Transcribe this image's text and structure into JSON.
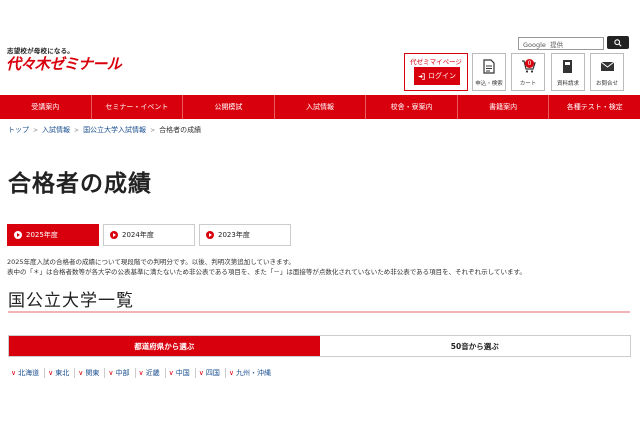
{
  "header": {
    "tagline": "志望校が母校になる。",
    "logo": "代ゼミ代々木ゼミナール",
    "logo_display": "代々木ゼミナール",
    "search": {
      "google_label": "Google",
      "provided": "提供"
    },
    "mypage": {
      "title": "代ゼミマイページ",
      "login_label": "ログイン"
    },
    "icons": [
      {
        "label": "申込・検索",
        "icon": "document-icon"
      },
      {
        "label": "カート",
        "icon": "cart-icon",
        "badge": "0"
      },
      {
        "label": "資料請求",
        "icon": "book-icon"
      },
      {
        "label": "お問合せ",
        "icon": "mail-icon"
      }
    ]
  },
  "nav": [
    "受講案内",
    "セミナー・イベント",
    "公開模試",
    "入試情報",
    "校舎・寮案内",
    "書籍案内",
    "各種テスト・検定"
  ],
  "breadcrumb": [
    "トップ",
    "入試情報",
    "国公立大学入試情報",
    "合格者の成績"
  ],
  "page_title": "合格者の成績",
  "year_tabs": [
    {
      "label": "2025年度",
      "active": true
    },
    {
      "label": "2024年度",
      "active": false
    },
    {
      "label": "2023年度",
      "active": false
    }
  ],
  "notes": [
    "2025年度入試の合格者の成績について現段階での判明分です。以後、判明次第追加していきます。",
    "表中の「＊」は合格者数等が各大学の公表基準に満たないため非公表である項目を、また「－」は面接等が点数化されていないため非公表である項目を、それぞれ示しています。"
  ],
  "section_title": "国公立大学一覧",
  "pick_tabs": [
    {
      "label": "都道府県から選ぶ",
      "active": true
    },
    {
      "label": "50音から選ぶ",
      "active": false
    }
  ],
  "regions": [
    "北海道",
    "東北",
    "関東",
    "中部",
    "近畿",
    "中国",
    "四国",
    "九州・沖縄"
  ],
  "colors": {
    "brand_red": "#d9000d",
    "link_blue": "#1a4f8f"
  }
}
